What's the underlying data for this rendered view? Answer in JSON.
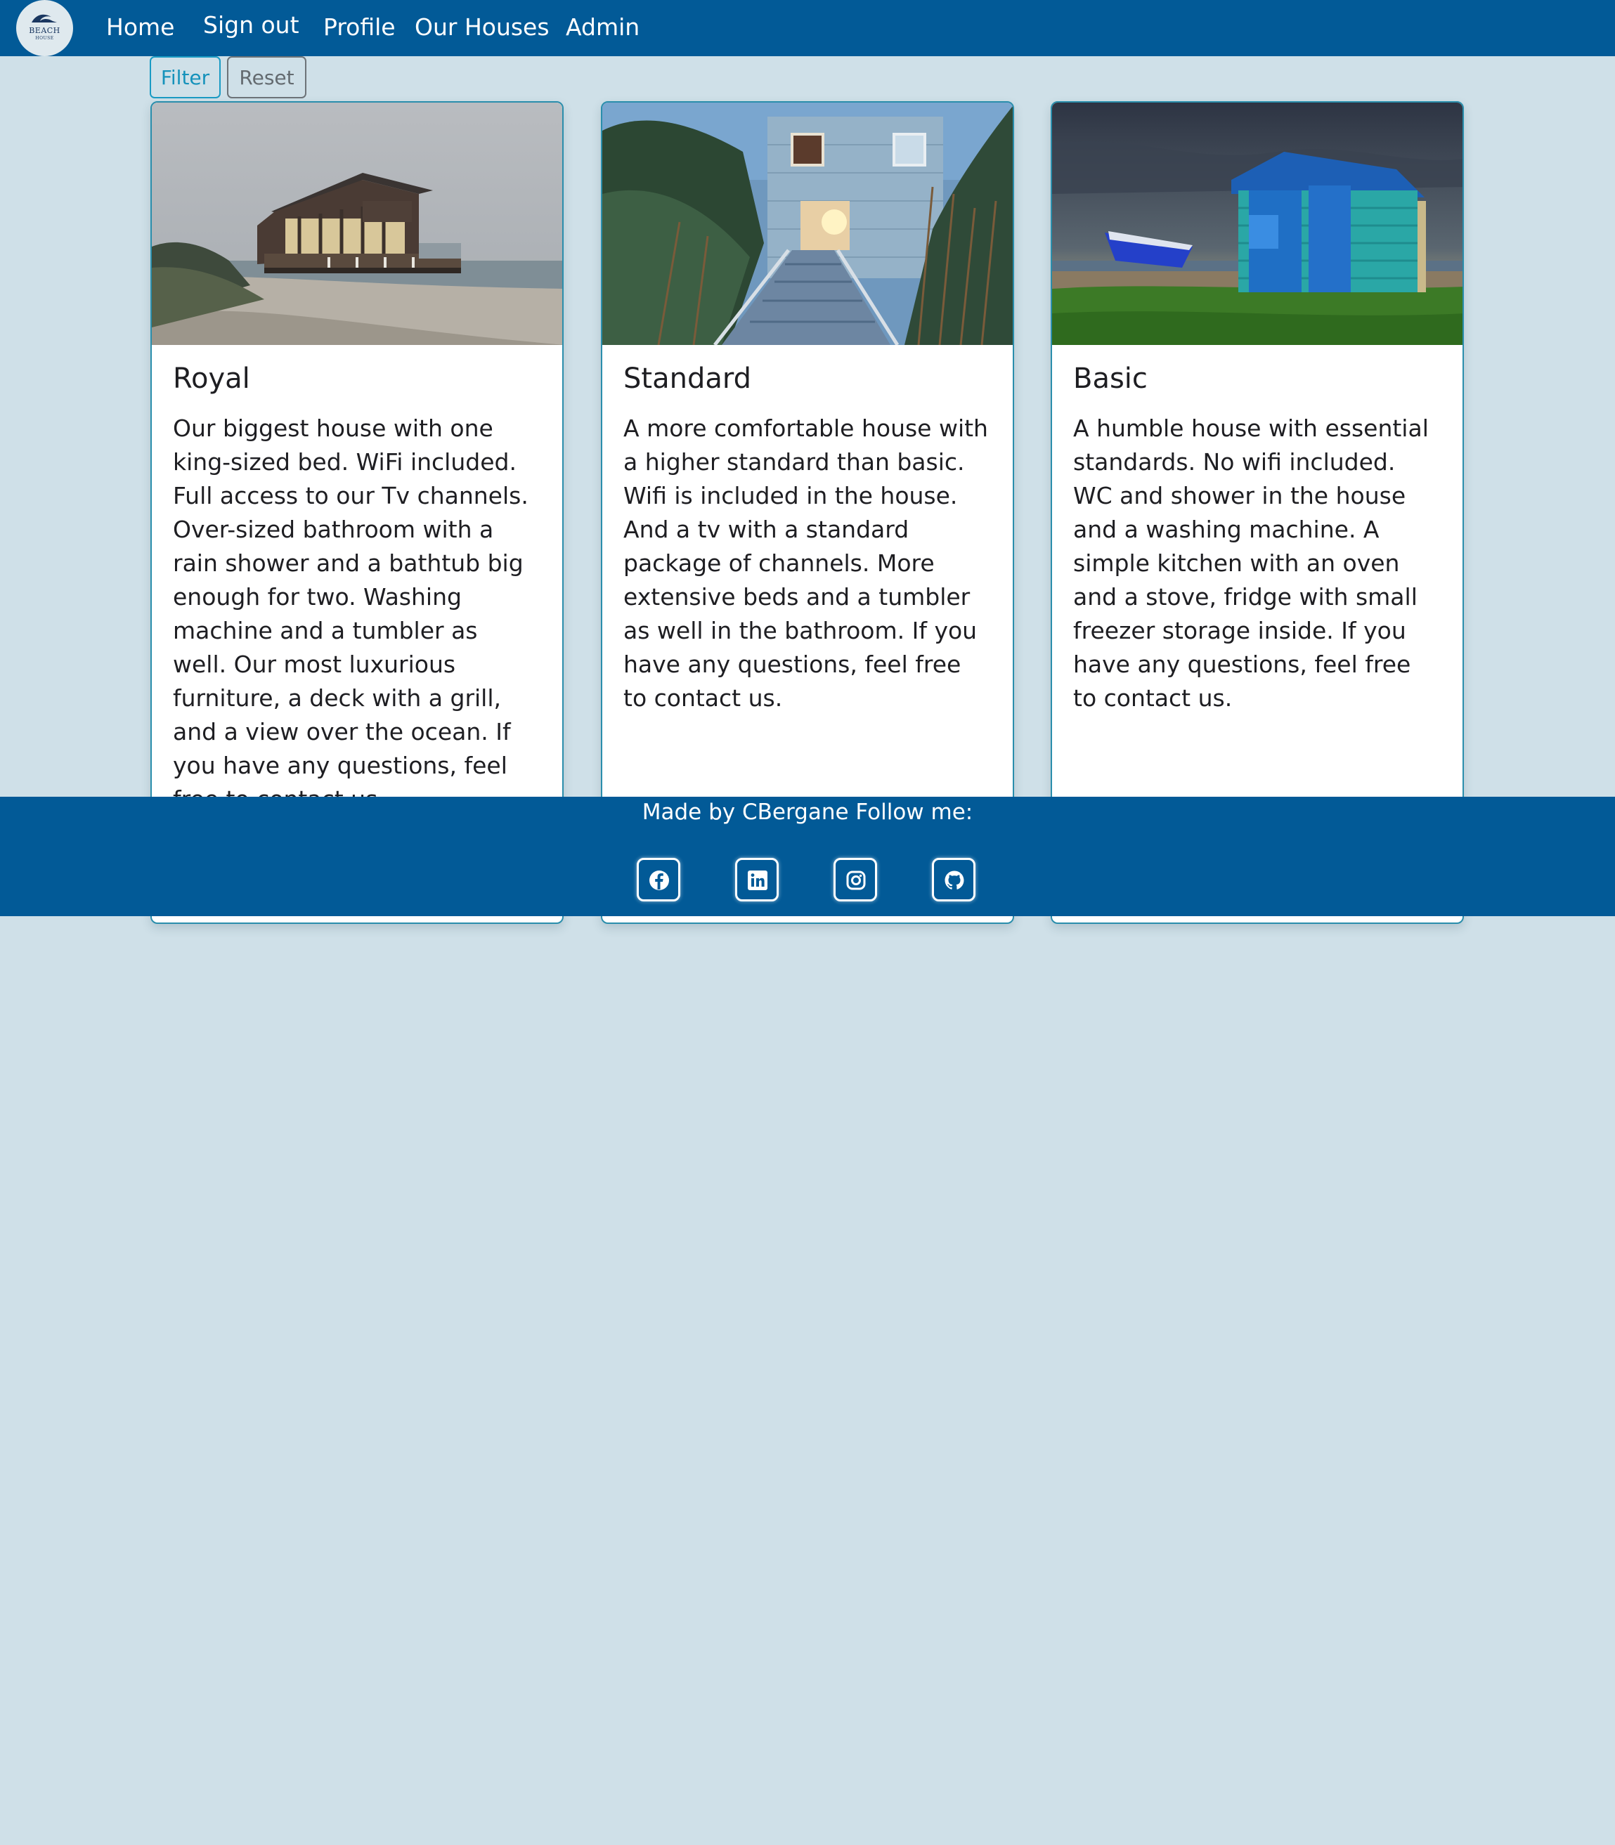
{
  "nav": {
    "logo_text": "BEACH",
    "logo_sub": "HOUSE",
    "links": [
      "Home",
      "Sign out",
      "Profile",
      "Our Houses",
      "Admin"
    ]
  },
  "controls": {
    "filter_label": "Filter",
    "reset_label": "Reset"
  },
  "cards": [
    {
      "title": "Royal",
      "description": "Our biggest house with one king-sized bed. WiFi included. Full access to our Tv channels. Over-sized bathroom with a rain shower and a bathtub big enough for two. Washing machine and a tumbler as well. Our most luxurious furniture, a deck with a grill, and a view over the ocean. If you have any questions, feel free to contact us."
    },
    {
      "title": "Standard",
      "description": "A more comfortable house with a higher standard than basic. Wifi is included in the house. And a tv with a standard package of channels. More extensive beds and a tumbler as well in the bathroom. If you have any questions, feel free to contact us."
    },
    {
      "title": "Basic",
      "description": "A humble house with essential standards. No wifi included. WC and shower in the house and a washing machine. A simple kitchen with an oven and a stove, fridge with small freezer storage inside. If you have any questions, feel free to contact us."
    }
  ],
  "footer": {
    "text": "Made by CBergane Follow me:",
    "social_icons": [
      "facebook-icon",
      "linkedin-icon",
      "instagram-icon",
      "github-icon"
    ]
  },
  "colors": {
    "navbar": "#025a97",
    "page_background": "#cfe0e8",
    "filter_accent": "#1592bb",
    "card_border": "#2a8eac"
  }
}
